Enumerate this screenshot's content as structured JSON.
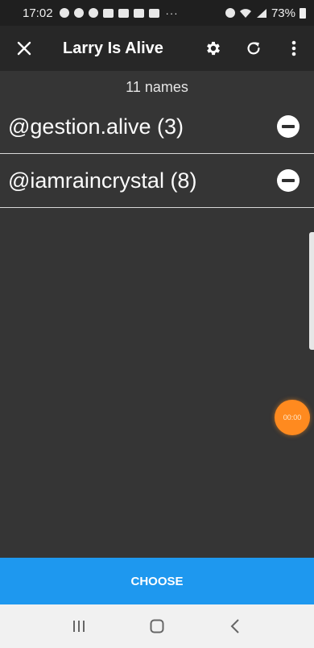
{
  "status": {
    "time": "17:02",
    "dots": "···",
    "battery": "73%"
  },
  "app_bar": {
    "title": "Larry Is Alive",
    "icons": [
      "close-icon",
      "gear-icon",
      "refresh-icon",
      "more-vert-icon"
    ]
  },
  "list": {
    "count_label": "11 names",
    "items": [
      {
        "label": "@gestion.alive (3)"
      },
      {
        "label": "@iamraincrystal (8)"
      }
    ]
  },
  "timer": {
    "label": "00:00"
  },
  "choose_button": {
    "label": "CHOOSE"
  },
  "colors": {
    "background": "#353535",
    "app_bar": "#272727",
    "accent": "#1e98ef",
    "timer": "#ff8a1f"
  }
}
